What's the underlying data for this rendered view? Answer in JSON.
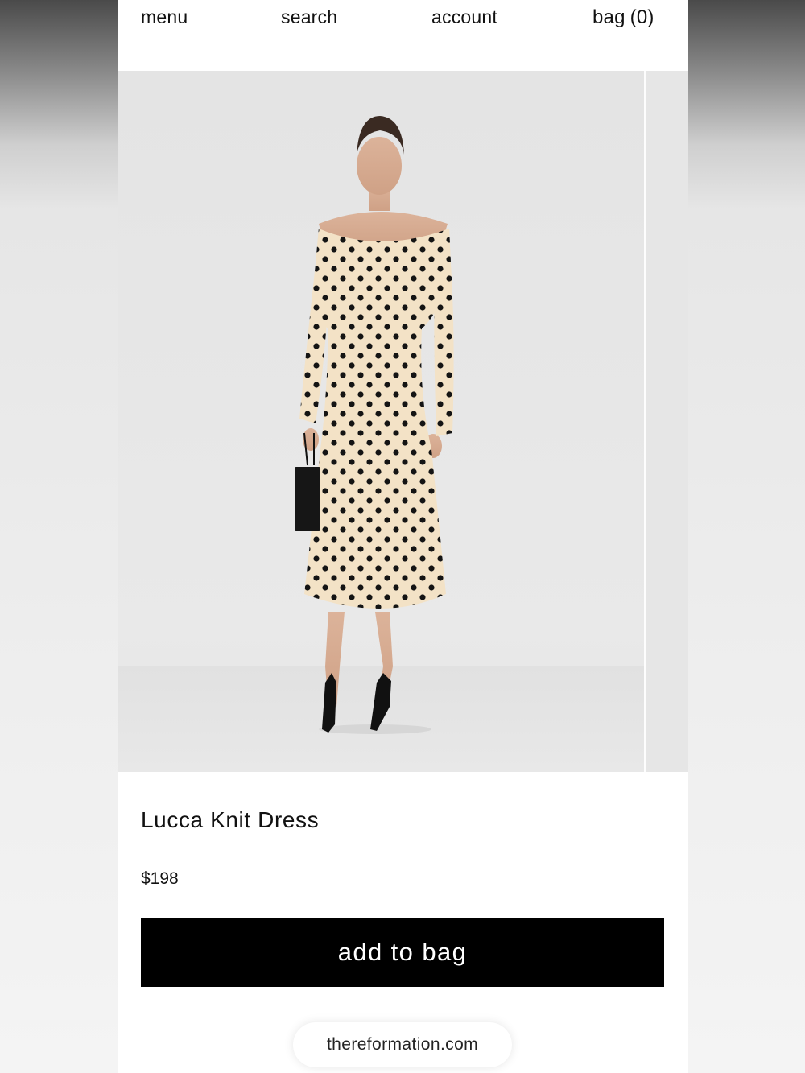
{
  "nav": {
    "menu_label": "menu",
    "search_label": "search",
    "account_label": "account",
    "bag_label": "bag",
    "bag_count": "(0)"
  },
  "product": {
    "name": "Lucca Knit Dress",
    "price": "$198",
    "add_to_bag_label": "add to bag"
  },
  "browser": {
    "url": "thereformation.com"
  },
  "colors": {
    "button_bg": "#000000",
    "dress": "#f3e2c6",
    "dots": "#111111"
  },
  "icons": {
    "product_image": "model-in-polka-dot-dress-image"
  }
}
